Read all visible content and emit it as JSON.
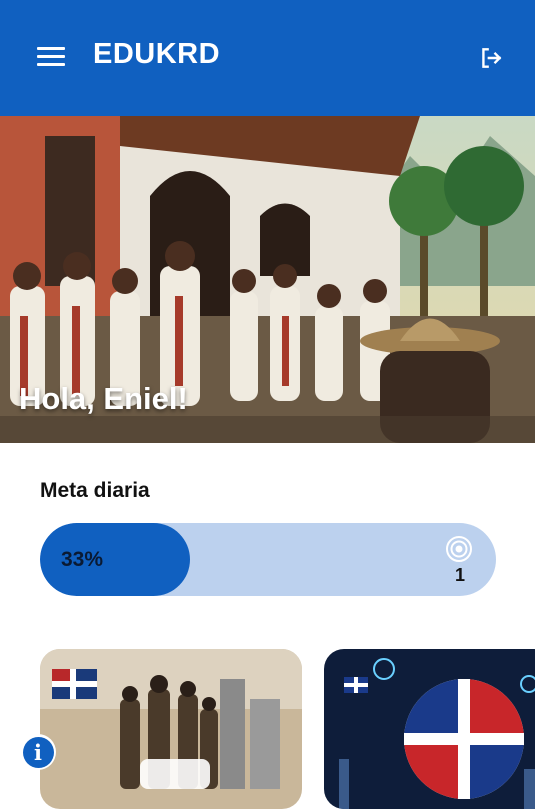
{
  "app": {
    "title": "EDUKRD"
  },
  "hero": {
    "greeting": "Hola, Eniel!"
  },
  "goal": {
    "title": "Meta diaria",
    "percent_label": "33%",
    "progress_fraction": 0.33,
    "target_count": "1"
  },
  "icons": {
    "menu": "hamburger-menu-icon",
    "logout": "logout-icon",
    "target": "target-icon",
    "info": "info-icon"
  },
  "colors": {
    "primary": "#1060c0",
    "progress_track": "#bcd1ee",
    "white": "#ffffff"
  }
}
